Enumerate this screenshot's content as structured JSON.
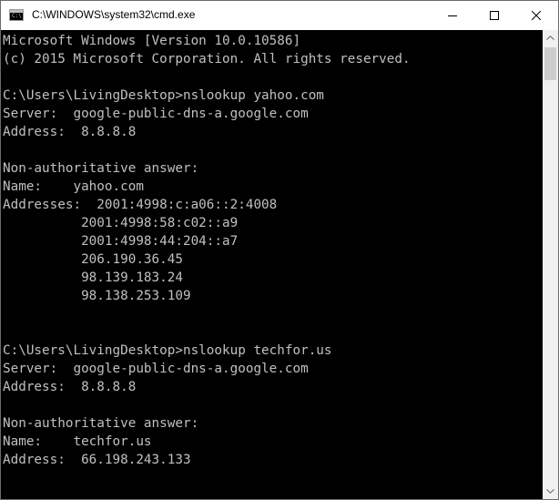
{
  "window": {
    "title": "C:\\WINDOWS\\system32\\cmd.exe",
    "icon": "console-icon",
    "icon_glyph": "C:\\"
  },
  "controls": {
    "minimize": "minimize-icon",
    "maximize": "maximize-icon",
    "close": "close-icon"
  },
  "console": {
    "foreground": "#c0c0c0",
    "background": "#000000",
    "lines": [
      "Microsoft Windows [Version 10.0.10586]",
      "(c) 2015 Microsoft Corporation. All rights reserved.",
      "",
      "C:\\Users\\LivingDesktop>nslookup yahoo.com",
      "Server:  google-public-dns-a.google.com",
      "Address:  8.8.8.8",
      "",
      "Non-authoritative answer:",
      "Name:    yahoo.com",
      "Addresses:  2001:4998:c:a06::2:4008",
      "          2001:4998:58:c02::a9",
      "          2001:4998:44:204::a7",
      "          206.190.36.45",
      "          98.139.183.24",
      "          98.138.253.109",
      "",
      "",
      "C:\\Users\\LivingDesktop>nslookup techfor.us",
      "Server:  google-public-dns-a.google.com",
      "Address:  8.8.8.8",
      "",
      "Non-authoritative answer:",
      "Name:    techfor.us",
      "Address:  66.198.243.133"
    ]
  },
  "scrollbar": {
    "up": "scroll-up-arrow-icon",
    "down": "scroll-down-arrow-icon"
  }
}
